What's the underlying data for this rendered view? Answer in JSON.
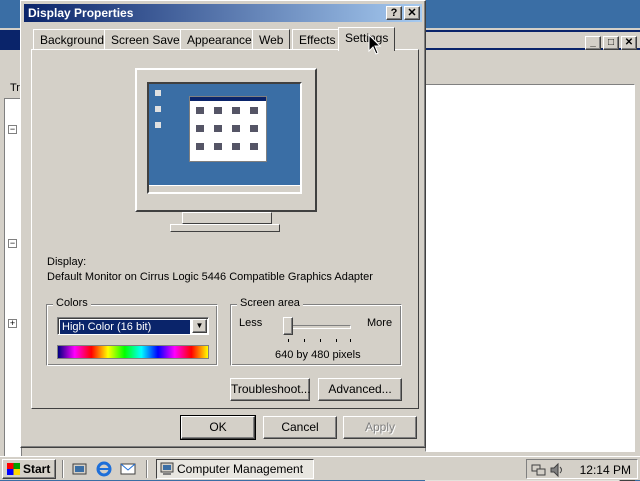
{
  "dialog": {
    "title": "Display Properties",
    "help_btn": "?",
    "close_btn": "✕",
    "tabs": [
      "Background",
      "Screen Saver",
      "Appearance",
      "Web",
      "Effects",
      "Settings"
    ],
    "active_tab": "Settings",
    "display_label": "Display:",
    "display_value": "Default Monitor on Cirrus Logic 5446 Compatible Graphics Adapter",
    "colors_group": "Colors",
    "colors_selected": "High Color (16 bit)",
    "screen_area_group": "Screen area",
    "less_label": "Less",
    "more_label": "More",
    "resolution_text": "640 by 480 pixels",
    "slider_level": 0,
    "troubleshoot_btn": "Troubleshoot...",
    "advanced_btn": "Advanced...",
    "ok_btn": "OK",
    "cancel_btn": "Cancel",
    "apply_btn": "Apply"
  },
  "background_window": {
    "tab_fragment": "Tr",
    "minimize": "_",
    "maximize": "□",
    "close": "✕"
  },
  "taskbar": {
    "start_label": "Start",
    "task_label": "Computer Management",
    "clock": "12:14 PM"
  },
  "colors": {
    "titlebar": "#0a246a",
    "face": "#d4d0c8",
    "desktop": "#3a6ea5"
  }
}
